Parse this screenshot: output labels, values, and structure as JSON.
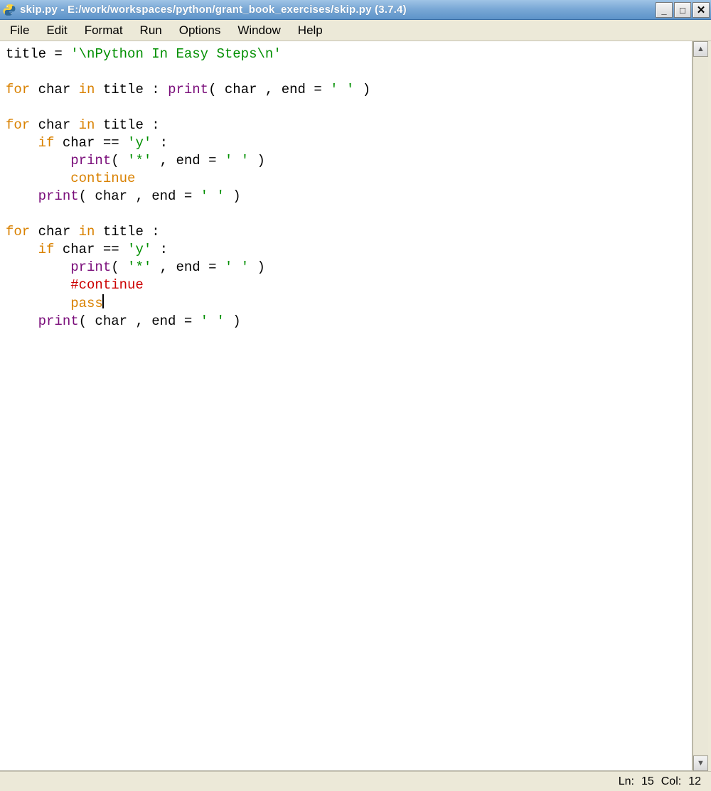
{
  "window": {
    "title": "skip.py - E:/work/workspaces/python/grant_book_exercises/skip.py (3.7.4)"
  },
  "menu": {
    "items": [
      "File",
      "Edit",
      "Format",
      "Run",
      "Options",
      "Window",
      "Help"
    ]
  },
  "code": {
    "lines": [
      [
        {
          "t": "title ",
          "c": "nm"
        },
        {
          "t": "= ",
          "c": "op"
        },
        {
          "t": "'",
          "c": "str"
        },
        {
          "t": "\\n",
          "c": "str"
        },
        {
          "t": "Python In Easy Steps",
          "c": "str"
        },
        {
          "t": "\\n",
          "c": "str"
        },
        {
          "t": "'",
          "c": "str"
        }
      ],
      [],
      [
        {
          "t": "for",
          "c": "kw"
        },
        {
          "t": " char ",
          "c": "nm"
        },
        {
          "t": "in",
          "c": "kw"
        },
        {
          "t": " title : ",
          "c": "nm"
        },
        {
          "t": "print",
          "c": "bi"
        },
        {
          "t": "( char , end = ",
          "c": "nm"
        },
        {
          "t": "' '",
          "c": "str"
        },
        {
          "t": " )",
          "c": "nm"
        }
      ],
      [],
      [
        {
          "t": "for",
          "c": "kw"
        },
        {
          "t": " char ",
          "c": "nm"
        },
        {
          "t": "in",
          "c": "kw"
        },
        {
          "t": " title :",
          "c": "nm"
        }
      ],
      [
        {
          "t": "    ",
          "c": "nm"
        },
        {
          "t": "if",
          "c": "kw"
        },
        {
          "t": " char == ",
          "c": "nm"
        },
        {
          "t": "'y'",
          "c": "str"
        },
        {
          "t": " :",
          "c": "nm"
        }
      ],
      [
        {
          "t": "        ",
          "c": "nm"
        },
        {
          "t": "print",
          "c": "bi"
        },
        {
          "t": "( ",
          "c": "nm"
        },
        {
          "t": "'*'",
          "c": "str"
        },
        {
          "t": " , end = ",
          "c": "nm"
        },
        {
          "t": "' '",
          "c": "str"
        },
        {
          "t": " )",
          "c": "nm"
        }
      ],
      [
        {
          "t": "        ",
          "c": "nm"
        },
        {
          "t": "continue",
          "c": "kw"
        }
      ],
      [
        {
          "t": "    ",
          "c": "nm"
        },
        {
          "t": "print",
          "c": "bi"
        },
        {
          "t": "( char , end = ",
          "c": "nm"
        },
        {
          "t": "' '",
          "c": "str"
        },
        {
          "t": " )",
          "c": "nm"
        }
      ],
      [],
      [
        {
          "t": "for",
          "c": "kw"
        },
        {
          "t": " char ",
          "c": "nm"
        },
        {
          "t": "in",
          "c": "kw"
        },
        {
          "t": " title :",
          "c": "nm"
        }
      ],
      [
        {
          "t": "    ",
          "c": "nm"
        },
        {
          "t": "if",
          "c": "kw"
        },
        {
          "t": " char == ",
          "c": "nm"
        },
        {
          "t": "'y'",
          "c": "str"
        },
        {
          "t": " :",
          "c": "nm"
        }
      ],
      [
        {
          "t": "        ",
          "c": "nm"
        },
        {
          "t": "print",
          "c": "bi"
        },
        {
          "t": "( ",
          "c": "nm"
        },
        {
          "t": "'*'",
          "c": "str"
        },
        {
          "t": " , end = ",
          "c": "nm"
        },
        {
          "t": "' '",
          "c": "str"
        },
        {
          "t": " )",
          "c": "nm"
        }
      ],
      [
        {
          "t": "        ",
          "c": "nm"
        },
        {
          "t": "#continue",
          "c": "cmt"
        }
      ],
      [
        {
          "t": "        ",
          "c": "nm"
        },
        {
          "t": "pass",
          "c": "kw"
        },
        {
          "cursor": true
        }
      ],
      [
        {
          "t": "    ",
          "c": "nm"
        },
        {
          "t": "print",
          "c": "bi"
        },
        {
          "t": "( char , end = ",
          "c": "nm"
        },
        {
          "t": "' '",
          "c": "str"
        },
        {
          "t": " )",
          "c": "nm"
        }
      ]
    ]
  },
  "status": {
    "ln_label": "Ln:",
    "ln_value": "15",
    "col_label": "Col:",
    "col_value": "12"
  },
  "scroll": {
    "up_glyph": "▲",
    "down_glyph": "▼"
  },
  "wincontrols": {
    "min_glyph": "_",
    "max_glyph": "□",
    "close_glyph": "✕"
  }
}
